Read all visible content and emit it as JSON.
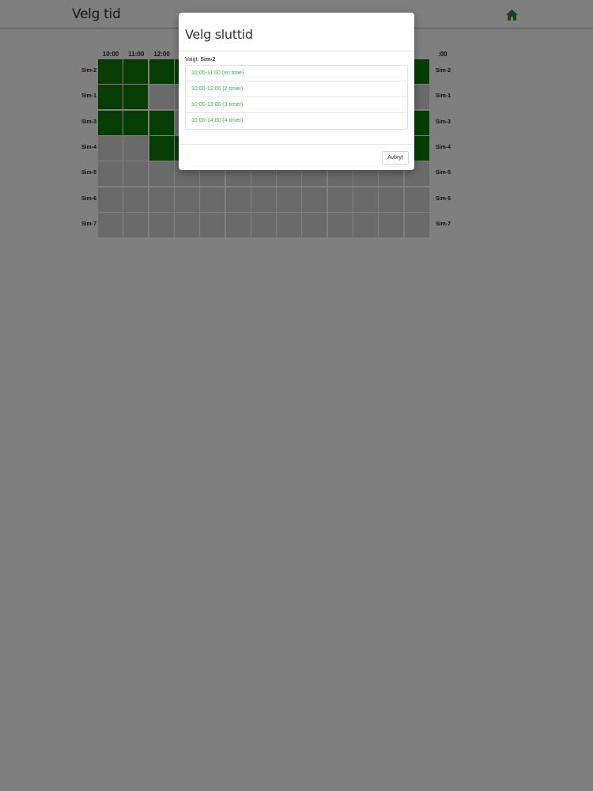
{
  "header": {
    "title": "Velg tid",
    "home_icon": "home-icon",
    "accent_color": "#2e8b2e"
  },
  "schedule": {
    "hours": [
      "10:00",
      "11:00",
      "12:00",
      "",
      "",
      "",
      "",
      "",
      "",
      "",
      "",
      "",
      "",
      ":00"
    ],
    "rows": [
      {
        "name": "Sim-2",
        "booked": [
          true,
          true,
          true,
          true,
          false,
          false,
          false,
          false,
          false,
          false,
          false,
          false,
          true
        ]
      },
      {
        "name": "Sim-1",
        "booked": [
          true,
          true,
          false,
          false,
          false,
          false,
          false,
          false,
          false,
          false,
          false,
          false,
          false
        ]
      },
      {
        "name": "Sim-3",
        "booked": [
          true,
          true,
          true,
          false,
          false,
          false,
          false,
          false,
          false,
          false,
          false,
          false,
          true
        ]
      },
      {
        "name": "Sim-4",
        "booked": [
          false,
          false,
          true,
          true,
          false,
          false,
          false,
          false,
          false,
          false,
          false,
          false,
          true
        ]
      },
      {
        "name": "Sim-5",
        "booked": [
          false,
          false,
          false,
          false,
          false,
          false,
          false,
          false,
          false,
          false,
          false,
          false,
          false
        ]
      },
      {
        "name": "Sim-6",
        "booked": [
          false,
          false,
          false,
          false,
          false,
          false,
          false,
          false,
          false,
          false,
          false,
          false,
          false
        ]
      },
      {
        "name": "Sim-7",
        "booked": [
          false,
          false,
          false,
          false,
          false,
          false,
          false,
          false,
          false,
          false,
          false,
          false,
          false
        ]
      }
    ],
    "booked_color": "#0a7a0a",
    "free_color": "#d4d4d4"
  },
  "modal": {
    "title": "Velg sluttid",
    "chosen_label": "Valgt:",
    "chosen_value": "Sim-2",
    "options": [
      "10:00-11:00 (en time)",
      "10:00-12:00 (2 timer)",
      "10:00-13:00 (3 timer)",
      "10:00-14:00 (4 timer)"
    ],
    "cancel_label": "Avbryt",
    "option_color": "#3cb34a"
  }
}
